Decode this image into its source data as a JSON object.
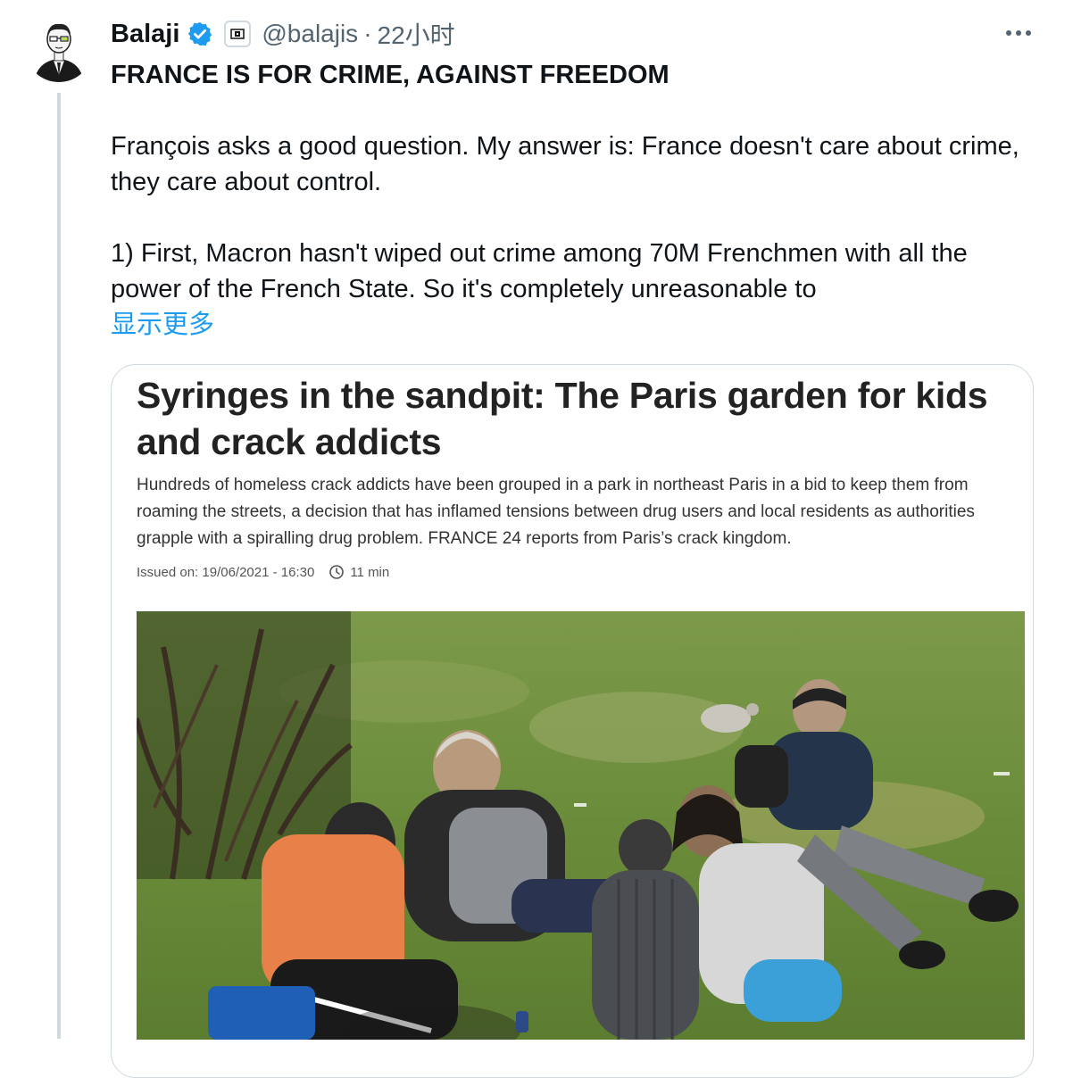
{
  "tweet": {
    "author_name": "Balaji",
    "handle": "@balajis",
    "separator": "·",
    "time": "22小时",
    "heading": "FRANCE IS FOR CRIME, AGAINST FREEDOM",
    "paragraph1": "François asks a good question. My answer is: France doesn't care about crime, they care about control.",
    "paragraph2": "1) First, Macron hasn't wiped out crime among 70M Frenchmen with all the power of the French State. So it's completely unreasonable to",
    "show_more": "显示更多"
  },
  "article": {
    "title": "Syringes in the sandpit: The Paris garden for kids and crack addicts",
    "summary": "Hundreds of homeless crack addicts have been grouped in a park in northeast Paris in a bid to keep them from roaming the streets, a decision that has inflamed tensions between drug users and local residents as authorities grapple with a spiralling drug problem. FRANCE 24 reports from Paris’s crack kingdom.",
    "issued": "Issued on: 19/06/2021 - 16:30",
    "read_time": "11 min"
  },
  "icons": {
    "verified": "verified-badge-icon",
    "affiliation": "affiliation-badge-icon",
    "more": "more-options-icon",
    "clock": "clock-icon"
  },
  "colors": {
    "accent": "#1d9bf0",
    "muted": "#536471",
    "border": "#cfd9de"
  }
}
